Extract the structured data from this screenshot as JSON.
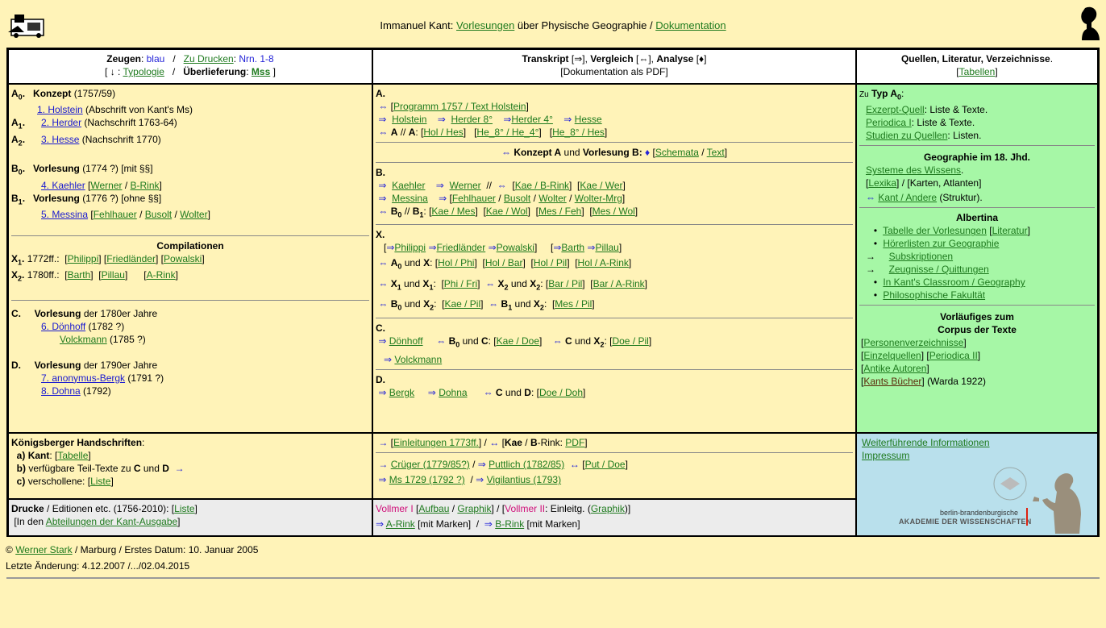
{
  "header": {
    "author": "Immanuel Kant",
    "vorlesungen": "Vorlesungen",
    "middle": "über Physische Geographie /",
    "dokumentation": "Dokumentation"
  },
  "col1_head": {
    "zeugen": "Zeugen",
    "blau": "blau",
    "zu_drucken": "Zu Drucken",
    "nrn": "Nrn. 1-8",
    "typologie": "Typologie",
    "ueberlieferung": "Überlieferung",
    "mss": "Mss"
  },
  "col2_head": {
    "transkript": "Transkript",
    "vergleich": "Vergleich",
    "analyse": "Analyse",
    "doku_pdf": "[Dokumentation als PDF]"
  },
  "col3_head": {
    "title": "Quellen, Literatur, Verzeichnisse",
    "tabellen": "Tabellen"
  },
  "col1": {
    "a0_label": "Konzept",
    "a0_year": "(1757/59)",
    "holstein": "1. Holstein",
    "holstein_note": "(Abschrift von Kant's Ms)",
    "herder": "2. Herder",
    "herder_note": "(Nachschrift 1763-64)",
    "hesse": "3. Hesse",
    "hesse_note": "(Nachschrift 1770)",
    "b0_label": "Vorlesung",
    "b0_note": "(1774 ?) [mit §§]",
    "kaehler": "4. Kaehler",
    "werner": "Werner",
    "b_rink": "B-Rink",
    "b1_label": "Vorlesung",
    "b1_note": "(1776 ?) [ohne §§]",
    "messina": "5. Messina",
    "fehlhauer": "Fehlhauer",
    "busolt": "Busolt",
    "wolter": "Wolter",
    "compilationen": "Compilationen",
    "x1_year": "1772ff.:",
    "philippi": "Philippi",
    "friedlaender": "Friedländer",
    "powalski": "Powalski",
    "x2_year": "1780ff.:",
    "barth": "Barth",
    "pillau": "Pillau",
    "a_rink": "A-Rink",
    "c_label": "Vorlesung",
    "c_note": "der 1780er Jahre",
    "doenhoff": "6. Dönhoff",
    "doenhoff_year": "(1782 ?)",
    "volckmann": "Volckmann",
    "volckmann_year": "(1785 ?)",
    "d_label": "Vorlesung",
    "d_note": "der 1790er Jahre",
    "anon": "7. anonymus-Bergk",
    "anon_year": "(1791 ?)",
    "dohna": "8. Dohna",
    "dohna_year": "(1792)"
  },
  "col2": {
    "programm": "Programm 1757 / Text Holstein",
    "holstein": "Holstein",
    "herder8": "Herder 8°",
    "herder4": "Herder 4°",
    "hesse": "Hesse",
    "hol_hes": "Hol / Hes",
    "he8_he4": "He_8° / He_4°",
    "he8_hes": "He_8° / Hes",
    "konzept_vorlesung": "Konzept A",
    "und": "und",
    "vorlesung_b": "Vorlesung B:",
    "schemata": "Schemata",
    "text": "Text",
    "kaehler": "Kaehler",
    "werner": "Werner",
    "kae_brink": "Kae / B-Rink",
    "kae_wer": "Kae / Wer",
    "messina": "Messina",
    "fehlhauer": "Fehlhauer",
    "busolt": "Busolt",
    "wolter": "Wolter",
    "wolter_mrg": "Wolter-Mrg",
    "kae_mes": "Kae / Mes",
    "kae_wol": "Kae / Wol",
    "mes_feh": "Mes / Feh",
    "mes_wol": "Mes / Wol",
    "philippi": "Philippi",
    "friedlaender": "Friedländer",
    "powalski": "Powalski",
    "barth": "Barth",
    "pillau": "Pillau",
    "hol_phi": "Hol / Phi",
    "hol_bar": "Hol / Bar",
    "hol_pil": "Hol / Pil",
    "hol_arink": "Hol / A-Rink",
    "phi_fri": "Phi / Fri",
    "bar_pil": "Bar / Pil",
    "bar_arink": "Bar / A-Rink",
    "kae_pil": "Kae / Pil",
    "mes_pil": "Mes / Pil",
    "doenhoff": "Dönhoff",
    "kae_doe": "Kae / Doe",
    "doe_pil": "Doe / Pil",
    "volckmann": "Volckmann",
    "bergk": "Bergk",
    "dohna": "Dohna",
    "doe_doh": "Doe / Doh"
  },
  "col3": {
    "zu": "Zu",
    "typ": "Typ A",
    "exzerpt": "Exzerpt-Quell",
    "exzerpt_note": ": Liste & Texte.",
    "periodica": "Periodica I",
    "periodica_note": ": Liste & Texte.",
    "studien": "Studien zu Quellen",
    "studien_note": ": Listen.",
    "geo_title": "Geographie im 18. Jhd.",
    "systeme": "Systeme des Wissens",
    "lexika": "Lexika",
    "lexika_note": "/ [Karten, Atlanten]",
    "kant_andere": "Kant / Andere",
    "kant_andere_note": "(Struktur).",
    "albertina": "Albertina",
    "tabelle_vorl": "Tabelle der Vorlesungen",
    "literatur": "Literatur",
    "hoererlisten": "Hörerlisten zur Geographie",
    "subskriptionen": "Subskriptionen",
    "zeugnisse": "Zeugnisse / Quittungen",
    "classroom": "In Kant's Classroom / Geography",
    "fakultaet": "Philosophische Fakultät",
    "vorlaeufiges": "Vorläufiges zum",
    "corpus": "Corpus der Texte",
    "personen": "Personenverzeichnisse",
    "einzelquellen": "Einzelquellen",
    "periodica2": "Periodica II",
    "antike": "Antike Autoren",
    "kants_buecher": "Kants Bücher",
    "warda": "(Warda 1922)"
  },
  "row2": {
    "koenigsberger": "Königsberger Handschriften",
    "a_kant": "Kant",
    "tabelle": "Tabelle",
    "b_text": "verfügbare Teil-Texte zu",
    "c_text": "verschollene:",
    "liste": "Liste",
    "einleitungen": "Einleitungen 1773ff.",
    "kae_brink": "Kae",
    "brink_pdf": "PDF",
    "crueger": "Crüger (1779/85?)",
    "puttlich": "Puttlich (1782/85)",
    "put_doe": "Put / Doe",
    "ms1729": "Ms 1729 (1792 ?)",
    "vigilantius": "Vigilantius (1793)",
    "weiterfuehrende": "Weiterführende Informationen",
    "impressum": "Impressum",
    "bbaw1": "berlin-brandenburgische",
    "bbaw2": "AKADEMIE DER WISSENSCHAFTEN"
  },
  "row3": {
    "drucke": "Drucke",
    "drucke_note": "/ Editionen etc. (1756-2010):",
    "liste": "Liste",
    "in_den": "[In den",
    "abteilungen": "Abteilungen der Kant-Ausgabe",
    "vollmer1": "Vollmer I",
    "aufbau": "Aufbau",
    "graphik": "Graphik",
    "vollmer2": "Vollmer II",
    "einleitg": ": Einleitg. (",
    "graphik2": "Graphik",
    "arink": "A-Rink",
    "mit_marken": "[mit Marken]",
    "brink": "B-Rink",
    "mit_marken2": "[mit Marken]"
  },
  "footer": {
    "copyright": "©",
    "author": "Werner Stark",
    "line1_rest": "/ Marburg / Erstes Datum: 10. Januar 2005",
    "line2": "Letzte Änderung: 4.12.2007 /.../02.04.2015"
  }
}
